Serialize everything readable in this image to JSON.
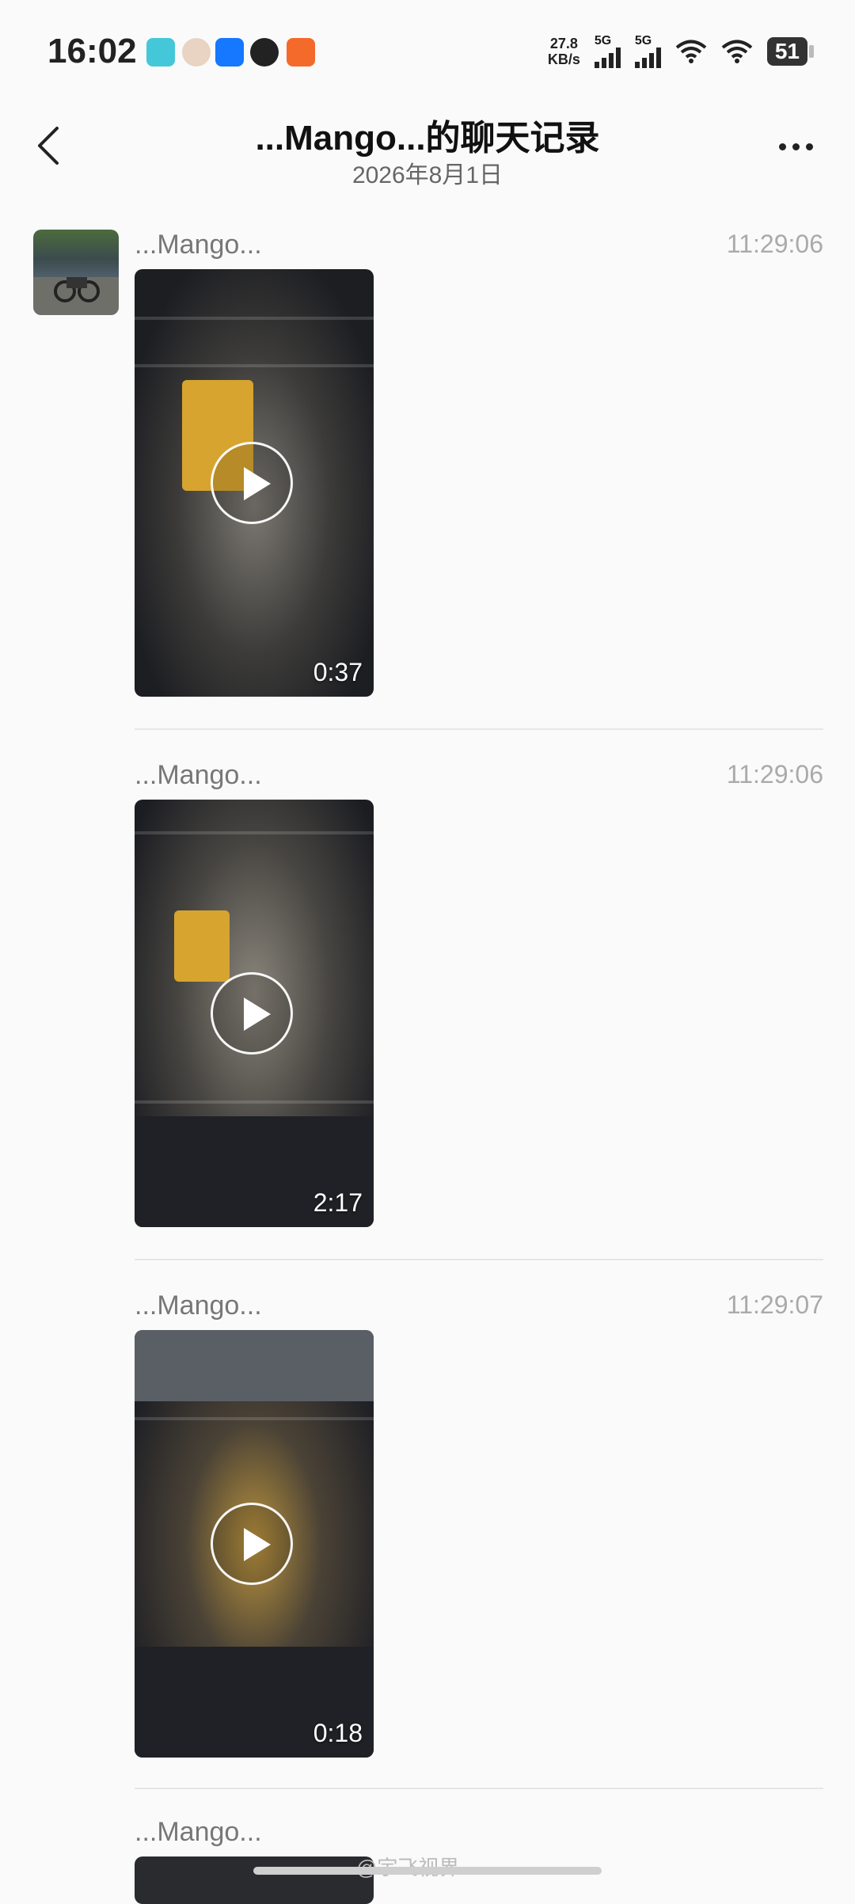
{
  "status": {
    "time": "16:02",
    "net_speed_value": "27.8",
    "net_speed_unit": "KB/s",
    "sim1": "5G",
    "sim2": "5G",
    "battery": "51"
  },
  "header": {
    "title": "...Mango...的聊天记录",
    "date": "2026年8月1日"
  },
  "messages": [
    {
      "sender": "...Mango...",
      "time": "11:29:06",
      "duration": "0:37"
    },
    {
      "sender": "...Mango...",
      "time": "11:29:06",
      "duration": "2:17"
    },
    {
      "sender": "...Mango...",
      "time": "11:29:07",
      "duration": "0:18"
    },
    {
      "sender": "...Mango..."
    }
  ],
  "watermark": "@宇飞视界",
  "icons": [
    "back-arrow-icon",
    "more-icon",
    "play-icon",
    "wifi-icon",
    "signal-icon",
    "battery-icon"
  ]
}
